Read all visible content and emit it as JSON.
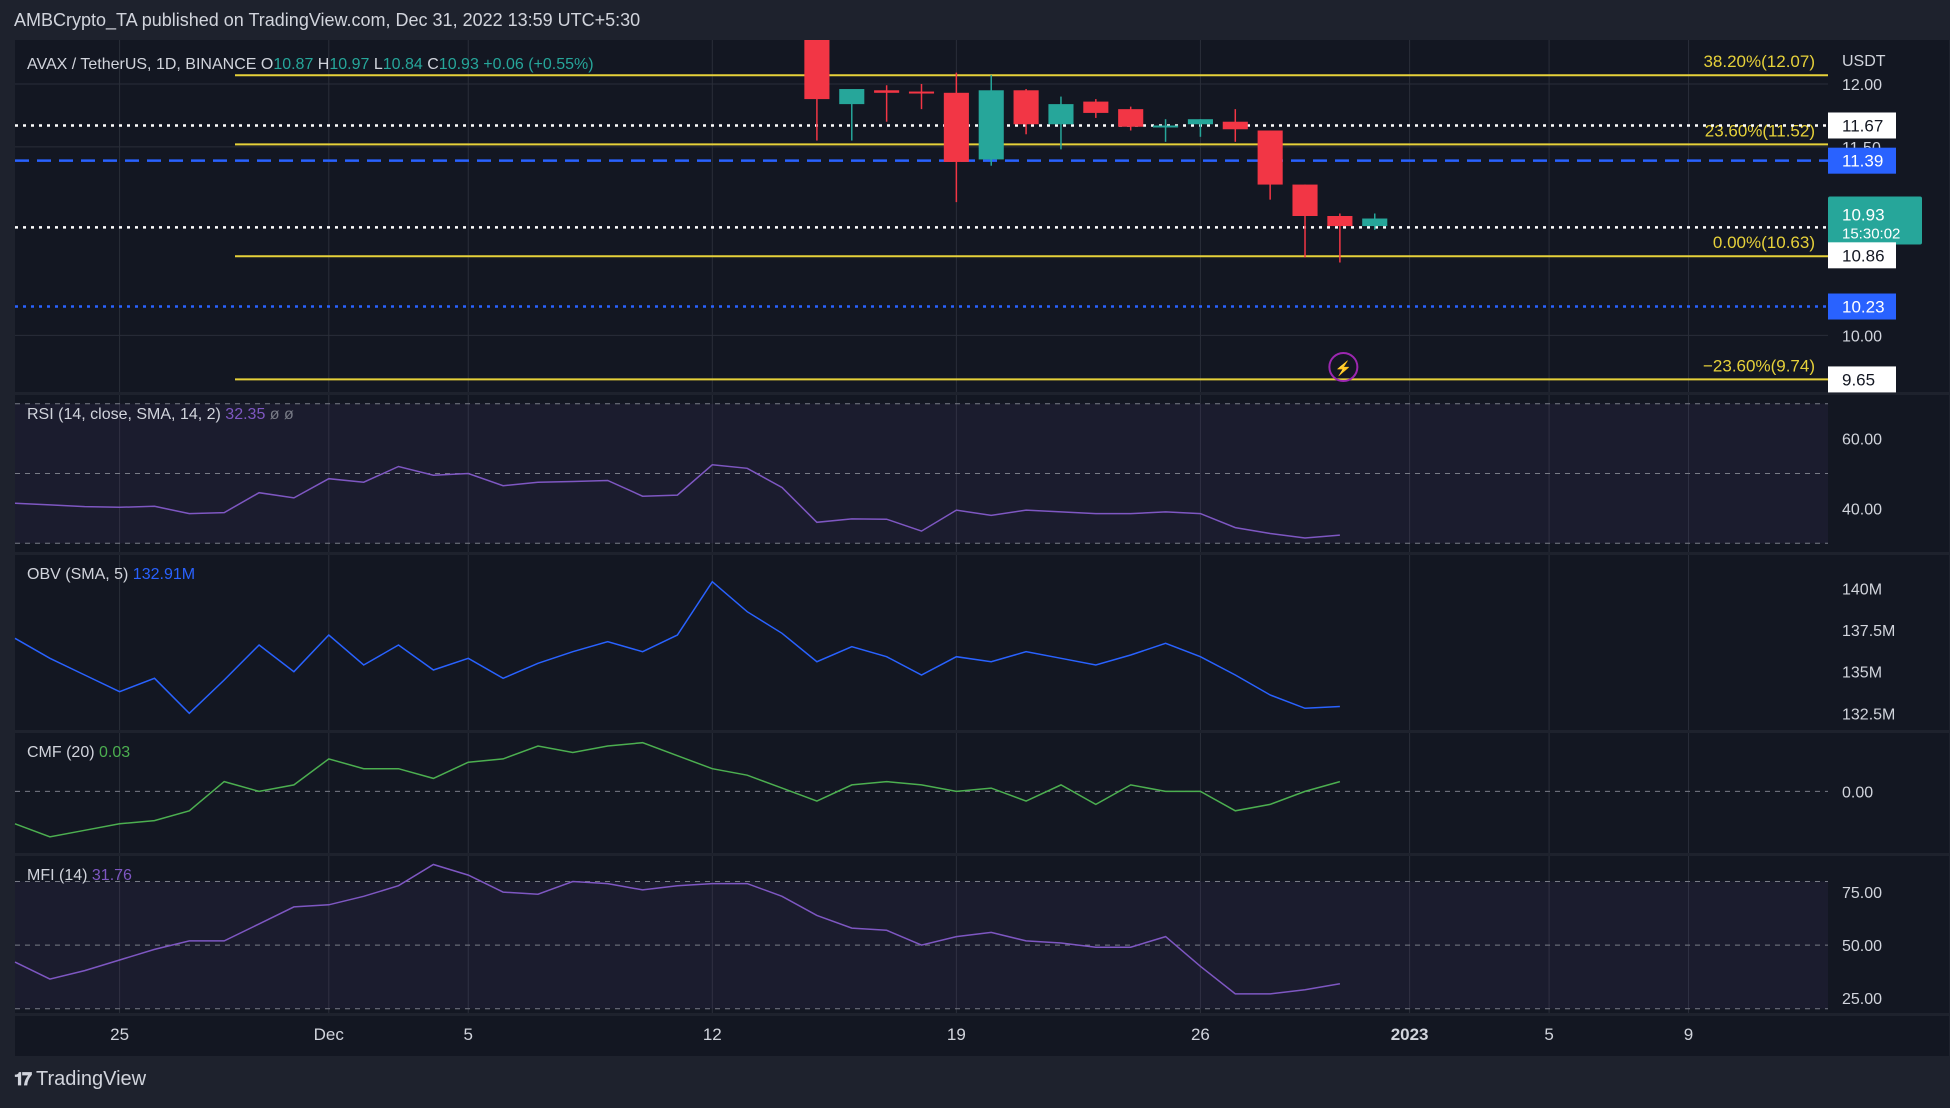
{
  "header": {
    "publisher_text": "AMBCrypto_TA published on TradingView.com, Dec 31, 2022 13:59 UTC+5:30"
  },
  "footer": {
    "brand": "TradingView"
  },
  "colors": {
    "background": "#1e222d",
    "pane": "#131722",
    "up": "#26a69a",
    "down": "#f23645",
    "fib": "#e6d13a",
    "blue_line": "#2962ff",
    "rsi": "#7e57c2",
    "obv": "#2962ff",
    "cmf": "#4caf50",
    "mfi": "#7e57c2",
    "text": "#d1d4dc"
  },
  "chart_data": {
    "type": "candlestick",
    "symbol_legend": {
      "symbol": "AVAX / TetherUS, 1D, BINANCE",
      "open_label": "O",
      "open": "10.87",
      "high_label": "H",
      "high": "10.97",
      "low_label": "L",
      "low": "10.84",
      "close_label": "C",
      "close": "10.93",
      "change": "+0.06 (+0.55%)"
    },
    "price_axis": {
      "unit": "USDT",
      "ticks": [
        "12.00",
        "11.50",
        "10.00"
      ],
      "range": [
        9.55,
        12.35
      ],
      "tags": {
        "white_upper": "11.67",
        "blue_upper": "11.39",
        "current": "10.93",
        "countdown": "15:30:02",
        "white_lower": "10.86",
        "blue_lower": "10.23",
        "fib_low": "9.65"
      }
    },
    "horizontal_lines": [
      {
        "price": 11.67,
        "style": "dotted",
        "color": "white"
      },
      {
        "price": 11.39,
        "style": "dashed",
        "color": "blue"
      },
      {
        "price": 10.86,
        "style": "dotted",
        "color": "white"
      },
      {
        "price": 10.23,
        "style": "dotted",
        "color": "blue"
      }
    ],
    "fib_levels": [
      {
        "label": "38.20%(12.07)",
        "price": 12.07
      },
      {
        "label": "23.60%(11.52)",
        "price": 11.52
      },
      {
        "label": "0.00%(10.63)",
        "price": 10.63
      },
      {
        "label": "−23.60%(9.74)",
        "price": 9.65
      }
    ],
    "candles": [
      {
        "date": "2022-12-15",
        "o": 12.45,
        "h": 12.45,
        "l": 11.55,
        "c": 11.88
      },
      {
        "date": "2022-12-16",
        "o": 11.84,
        "h": 11.95,
        "l": 11.55,
        "c": 11.96
      },
      {
        "date": "2022-12-17",
        "o": 11.95,
        "h": 11.99,
        "l": 11.7,
        "c": 11.93
      },
      {
        "date": "2022-12-18",
        "o": 11.94,
        "h": 12.0,
        "l": 11.8,
        "c": 11.93
      },
      {
        "date": "2022-12-19",
        "o": 11.93,
        "h": 12.09,
        "l": 11.06,
        "c": 11.38
      },
      {
        "date": "2022-12-20",
        "o": 11.4,
        "h": 12.07,
        "l": 11.35,
        "c": 11.95
      },
      {
        "date": "2022-12-21",
        "o": 11.95,
        "h": 11.96,
        "l": 11.6,
        "c": 11.68
      },
      {
        "date": "2022-12-22",
        "o": 11.68,
        "h": 11.9,
        "l": 11.48,
        "c": 11.84
      },
      {
        "date": "2022-12-23",
        "o": 11.86,
        "h": 11.88,
        "l": 11.73,
        "c": 11.77
      },
      {
        "date": "2022-12-24",
        "o": 11.8,
        "h": 11.82,
        "l": 11.63,
        "c": 11.66
      },
      {
        "date": "2022-12-25",
        "o": 11.67,
        "h": 11.72,
        "l": 11.54,
        "c": 11.67
      },
      {
        "date": "2022-12-26",
        "o": 11.68,
        "h": 11.72,
        "l": 11.58,
        "c": 11.72
      },
      {
        "date": "2022-12-27",
        "o": 11.7,
        "h": 11.8,
        "l": 11.54,
        "c": 11.64
      },
      {
        "date": "2022-12-28",
        "o": 11.63,
        "h": 11.63,
        "l": 11.08,
        "c": 11.2
      },
      {
        "date": "2022-12-29",
        "o": 11.2,
        "h": 11.2,
        "l": 10.62,
        "c": 10.95
      },
      {
        "date": "2022-12-30",
        "o": 10.95,
        "h": 10.97,
        "l": 10.58,
        "c": 10.87
      },
      {
        "date": "2022-12-31",
        "o": 10.87,
        "h": 10.97,
        "l": 10.84,
        "c": 10.93
      }
    ],
    "x_axis": {
      "labels": [
        "25",
        "Dec",
        "5",
        "12",
        "19",
        "26",
        "2023",
        "5",
        "9"
      ],
      "label_dates": [
        "2022-11-25",
        "2022-12-01",
        "2022-12-05",
        "2022-12-12",
        "2022-12-19",
        "2022-12-26",
        "2023-01-01",
        "2023-01-05",
        "2023-01-09"
      ],
      "range": [
        "2022-11-22",
        "2023-01-13"
      ]
    },
    "indicators": [
      {
        "name": "RSI (14, close, SMA, 14, 2)",
        "last": "32.35",
        "extra": "ø ø",
        "band": [
          30,
          70
        ],
        "range": [
          27.5,
          72.5
        ],
        "ticks": [
          "60.00",
          "40.00"
        ],
        "tick_values": [
          60,
          40
        ],
        "start": "2022-11-22",
        "values": [
          41.5,
          41,
          40.5,
          40.3,
          40.6,
          38.5,
          38.8,
          44.5,
          43,
          48.5,
          47.5,
          52,
          49.5,
          50,
          46.5,
          47.5,
          47.7,
          48,
          43.5,
          43.8,
          52.5,
          51.5,
          46,
          36,
          37,
          36.9,
          33.5,
          39.5,
          38,
          39.5,
          39,
          38.5,
          38.5,
          39,
          38.5,
          34.5,
          32.8,
          31.5,
          32.35
        ]
      },
      {
        "name": "OBV (SMA, 5)",
        "last": "132.91M",
        "range": [
          131.5,
          142
        ],
        "ticks": [
          "140M",
          "137.5M",
          "135M",
          "132.5M"
        ],
        "tick_values": [
          140,
          137.5,
          135,
          132.5
        ],
        "start": "2022-11-22",
        "values": [
          137,
          135.8,
          134.8,
          133.8,
          134.6,
          132.5,
          134.5,
          136.6,
          135,
          137.2,
          135.4,
          136.6,
          135.1,
          135.8,
          134.6,
          135.5,
          136.2,
          136.8,
          136.2,
          137.2,
          140.4,
          138.6,
          137.3,
          135.6,
          136.5,
          135.9,
          134.8,
          135.9,
          135.6,
          136.2,
          135.8,
          135.4,
          136,
          136.7,
          135.9,
          134.8,
          133.6,
          132.8,
          132.91
        ]
      },
      {
        "name": "CMF (20)",
        "last": "0.03",
        "range": [
          -0.19,
          0.18
        ],
        "ticks": [
          "0.00"
        ],
        "tick_values": [
          0
        ],
        "start": "2022-11-22",
        "values": [
          -0.1,
          -0.14,
          -0.12,
          -0.1,
          -0.09,
          -0.06,
          0.03,
          0,
          0.02,
          0.1,
          0.07,
          0.07,
          0.04,
          0.09,
          0.1,
          0.14,
          0.12,
          0.14,
          0.15,
          0.11,
          0.07,
          0.05,
          0.01,
          -0.03,
          0.02,
          0.03,
          0.02,
          0,
          0.01,
          -0.03,
          0.02,
          -0.04,
          0.02,
          0,
          0,
          -0.06,
          -0.04,
          0,
          0.03
        ]
      },
      {
        "name": "MFI (14)",
        "last": "31.76",
        "band": [
          20,
          80
        ],
        "range": [
          18,
          92
        ],
        "ticks": [
          "75.00",
          "50.00",
          "25.00"
        ],
        "tick_values": [
          75,
          50,
          25
        ],
        "start": "2022-11-22",
        "values": [
          42,
          34,
          38,
          43,
          48,
          52,
          52,
          60,
          68,
          69,
          73,
          78,
          88,
          83,
          75,
          74,
          80,
          79,
          76,
          78,
          79,
          79,
          73,
          64,
          58,
          57,
          50,
          54,
          56,
          52,
          51,
          49,
          49,
          54,
          40,
          27,
          27,
          29,
          31.76
        ]
      }
    ],
    "grid": true
  }
}
